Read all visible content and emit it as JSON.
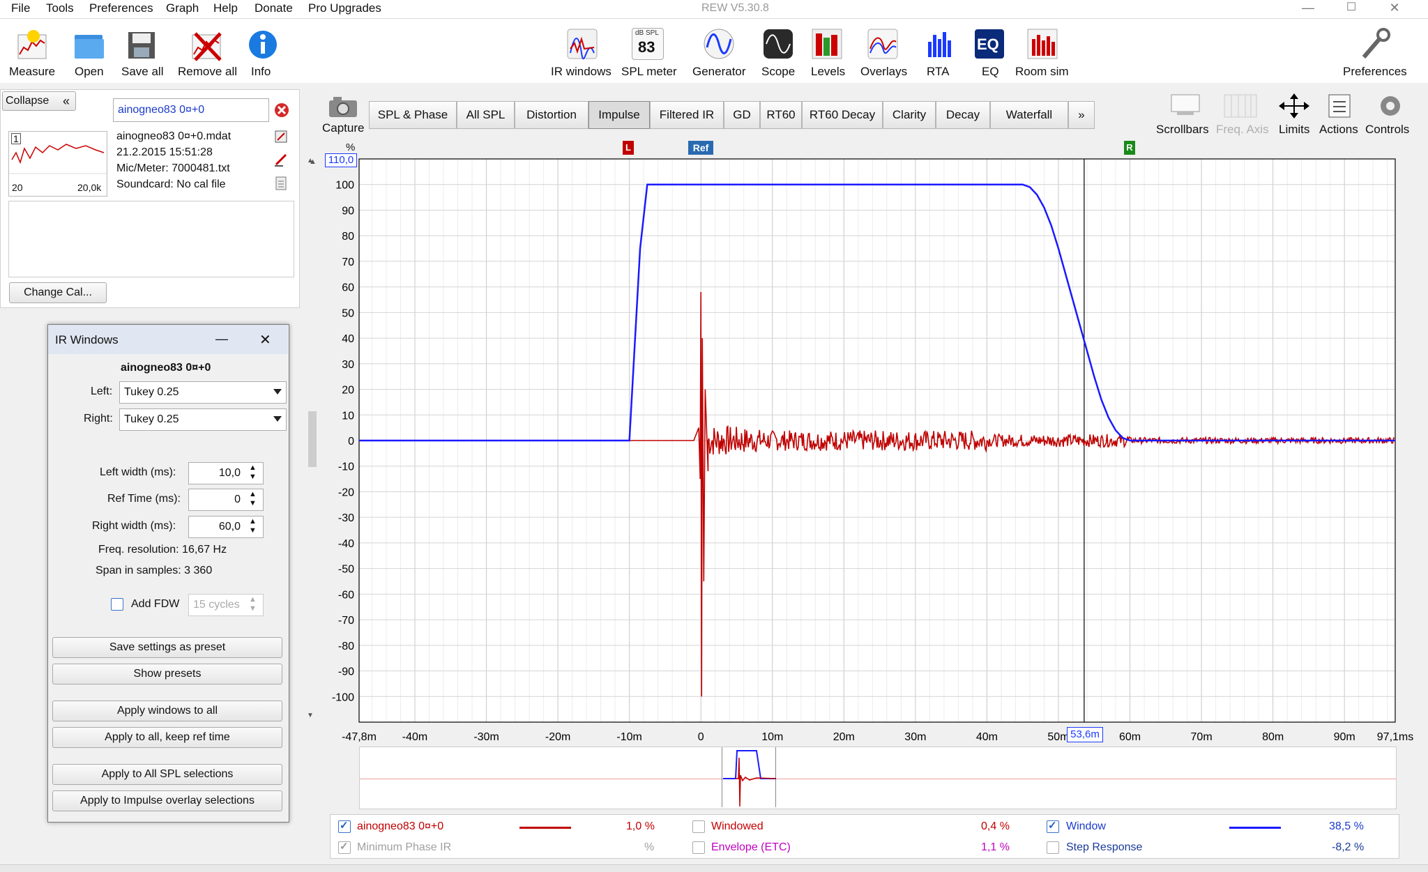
{
  "window": {
    "title": "REW V5.30.8",
    "controls": [
      "—",
      "☐",
      "✕"
    ]
  },
  "menu": [
    "File",
    "Tools",
    "Preferences",
    "Graph",
    "Help",
    "Donate",
    "Pro Upgrades"
  ],
  "toolbar": {
    "left": [
      {
        "label": "Measure",
        "icon": "measure-icon"
      },
      {
        "label": "Open",
        "icon": "folder-icon"
      },
      {
        "label": "Save all",
        "icon": "save-icon"
      },
      {
        "label": "Remove all",
        "icon": "remove-icon"
      },
      {
        "label": "Info",
        "icon": "info-icon"
      }
    ],
    "center": [
      {
        "label": "IR windows",
        "icon": "ir-windows-icon"
      },
      {
        "label": "SPL meter",
        "icon": "spl-meter-icon",
        "badge_top": "dB SPL",
        "badge_value": "83"
      },
      {
        "label": "Generator",
        "icon": "generator-icon"
      },
      {
        "label": "Scope",
        "icon": "scope-icon"
      },
      {
        "label": "Levels",
        "icon": "levels-icon"
      },
      {
        "label": "Overlays",
        "icon": "overlays-icon"
      },
      {
        "label": "RTA",
        "icon": "rta-icon"
      },
      {
        "label": "EQ",
        "icon": "eq-icon"
      },
      {
        "label": "Room sim",
        "icon": "room-sim-icon"
      }
    ],
    "preferences": "Preferences"
  },
  "measurement": {
    "collapse": "Collapse",
    "collapse_chevron": "«",
    "name": "ainogneo83 0¤+0",
    "index": "1",
    "thumb_min": "20",
    "thumb_max": "20,0k",
    "file": "ainogneo83 0¤+0.mdat",
    "date": "21.2.2015 15:51:28",
    "mic": "Mic/Meter: 7000481.txt",
    "soundcard": "Soundcard: No cal file",
    "change_cal": "Change Cal..."
  },
  "ir_windows": {
    "title": "IR Windows",
    "minimize": "—",
    "close": "✕",
    "name": "ainogneo83 0¤+0",
    "left_label": "Left:",
    "left_value": "Tukey 0.25",
    "right_label": "Right:",
    "right_value": "Tukey 0.25",
    "left_width_label": "Left width (ms):",
    "left_width_value": "10,0",
    "ref_time_label": "Ref Time (ms):",
    "ref_time_value": "0",
    "right_width_label": "Right width (ms):",
    "right_width_value": "60,0",
    "freq_res": "Freq. resolution: 16,67 Hz",
    "span": "Span in samples: 3 360",
    "add_fdw": "Add FDW",
    "fdw_cycles": "15 cycles",
    "buttons": [
      "Save settings as preset",
      "Show presets",
      "Apply windows to all",
      "Apply to all, keep ref time",
      "Apply to All SPL selections",
      "Apply to Impulse overlay selections"
    ]
  },
  "capture_label": "Capture",
  "tabs": [
    {
      "label": "SPL & Phase",
      "active": false
    },
    {
      "label": "All SPL",
      "active": false
    },
    {
      "label": "Distortion",
      "active": false
    },
    {
      "label": "Impulse",
      "active": true
    },
    {
      "label": "Filtered IR",
      "active": false
    },
    {
      "label": "GD",
      "active": false
    },
    {
      "label": "RT60",
      "active": false
    },
    {
      "label": "RT60 Decay",
      "active": false
    },
    {
      "label": "Clarity",
      "active": false
    },
    {
      "label": "Decay",
      "active": false
    },
    {
      "label": "Waterfall",
      "active": false
    },
    {
      "label": "»",
      "active": false
    }
  ],
  "right_tools": [
    {
      "label": "Scrollbars",
      "icon": "scrollbars-icon",
      "enabled": true
    },
    {
      "label": "Freq. Axis",
      "icon": "freq-axis-icon",
      "enabled": false
    },
    {
      "label": "Limits",
      "icon": "limits-icon",
      "enabled": true
    },
    {
      "label": "Actions",
      "icon": "actions-icon",
      "enabled": true
    },
    {
      "label": "Controls",
      "icon": "gear-icon",
      "enabled": true
    }
  ],
  "graph": {
    "y_unit": "%",
    "y_top_box": "110,0",
    "cursor_box": "53,6m",
    "markers": {
      "left": "L",
      "ref": "Ref",
      "right": "R"
    },
    "colors": {
      "impulse": "#c00000",
      "window": "#1a1aff"
    }
  },
  "chart_data": {
    "type": "line",
    "title": "",
    "xlabel": "",
    "ylabel": "%",
    "xlim": [
      -47.8,
      97.1
    ],
    "ylim": [
      -110,
      110
    ],
    "x_unit": "ms",
    "y_ticks": [
      100,
      90,
      80,
      70,
      60,
      50,
      40,
      30,
      20,
      10,
      0,
      -10,
      -20,
      -30,
      -40,
      -50,
      -60,
      -70,
      -80,
      -90,
      -100
    ],
    "x_tick_labels": [
      "-47,8m",
      "-40m",
      "-30m",
      "-20m",
      "-10m",
      "0",
      "10m",
      "20m",
      "30m",
      "40m",
      "50m",
      "60m",
      "70m",
      "80m",
      "90m",
      "97,1ms"
    ],
    "x_tick_values": [
      -47.8,
      -40,
      -30,
      -20,
      -10,
      0,
      10,
      20,
      30,
      40,
      50,
      60,
      70,
      80,
      90,
      97.1
    ],
    "cursor_x": 53.6,
    "series": [
      {
        "name": "Window",
        "color": "#1a1aff",
        "x": [
          -47.8,
          -10,
          -9.5,
          -8.5,
          -7.5,
          45,
          46,
          47,
          48,
          49,
          50,
          51,
          52,
          53,
          54,
          55,
          56,
          57,
          58,
          59,
          60,
          97.1
        ],
        "values": [
          0,
          0,
          25,
          75,
          100,
          100,
          99,
          96,
          91,
          84,
          75,
          65,
          55,
          45,
          35,
          25,
          16,
          9,
          4,
          1,
          0,
          0
        ]
      },
      {
        "name": "ainogneo83 0¤+0",
        "color": "#c00000",
        "x": [
          -47.8,
          -1,
          -0.3,
          -0.1,
          0,
          0.1,
          0.2,
          0.4,
          0.6,
          1,
          1.5,
          2,
          3,
          4,
          5,
          6,
          8,
          10,
          15,
          20,
          30,
          97.1
        ],
        "values": [
          0,
          0,
          5,
          -15,
          58,
          -100,
          40,
          -55,
          20,
          -12,
          18,
          -8,
          6,
          -5,
          10,
          -4,
          5,
          -3,
          4,
          -3,
          2,
          0
        ]
      }
    ]
  },
  "legend": {
    "row1": [
      {
        "label": "ainogneo83 0¤+0",
        "checked": true,
        "color": "#c00000",
        "value": "1,0 %"
      },
      {
        "label": "Windowed",
        "checked": false,
        "color": "#c00000",
        "value": "0,4 %"
      },
      {
        "label": "Window",
        "checked": true,
        "color": "#1a1aff",
        "value": "38,5 %"
      }
    ],
    "row2": [
      {
        "label": "Minimum Phase IR",
        "checked": true,
        "color": "#a0a0a0",
        "value": "%"
      },
      {
        "label": "Envelope (ETC)",
        "checked": false,
        "color": "#c000c0",
        "value": "1,1 %"
      },
      {
        "label": "Step Response",
        "checked": false,
        "color": "#1a3a9a",
        "value": "-8,2 %"
      }
    ]
  }
}
